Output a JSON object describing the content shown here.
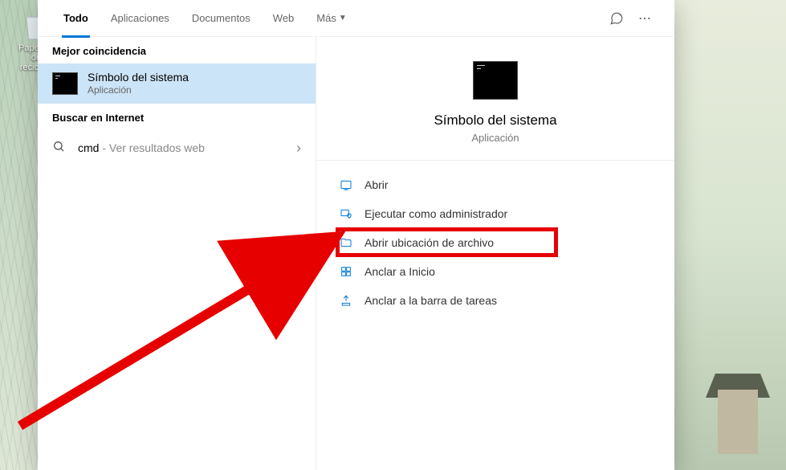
{
  "desktop": {
    "recycle_bin_label": "Papelera de reciclaje"
  },
  "tabs": {
    "todo": "Todo",
    "aplicaciones": "Aplicaciones",
    "documentos": "Documentos",
    "web": "Web",
    "mas": "Más"
  },
  "sections": {
    "best_match": "Mejor coincidencia",
    "search_web": "Buscar en Internet"
  },
  "best_match": {
    "title": "Símbolo del sistema",
    "subtitle": "Aplicación"
  },
  "web_search": {
    "query": "cmd",
    "suffix": " - Ver resultados web"
  },
  "detail": {
    "title": "Símbolo del sistema",
    "subtitle": "Aplicación"
  },
  "actions": {
    "open": "Abrir",
    "run_admin": "Ejecutar como administrador",
    "open_location": "Abrir ubicación de archivo",
    "pin_start": "Anclar a Inicio",
    "pin_taskbar": "Anclar a la barra de tareas"
  }
}
